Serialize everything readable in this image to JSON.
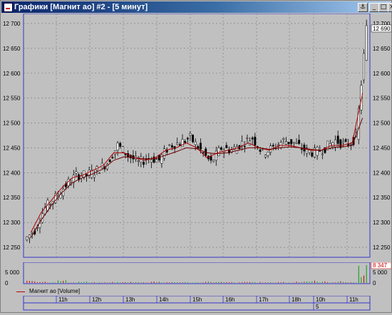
{
  "window": {
    "title": "Графики [Магнит ао] #2 - [5 минут]",
    "buttons": [
      "⚓",
      "_",
      "□",
      "×"
    ]
  },
  "legend": {
    "label": "Магнит ао [Volume]",
    "color": "#b00000"
  },
  "price_axis": {
    "ticks": [
      "12 700",
      "12 650",
      "12 600",
      "12 550",
      "12 500",
      "12 450",
      "12 400",
      "12 350",
      "12 300",
      "12 250"
    ],
    "last_price": "12 690"
  },
  "volume_axis": {
    "ticks": [
      "5 000",
      "0"
    ],
    "last_volume": "8 347"
  },
  "time_axis": {
    "labels": [
      "11h",
      "12h",
      "13h",
      "14h",
      "15h",
      "16h",
      "17h",
      "18h",
      "10h",
      "11h"
    ],
    "date_label": "5"
  },
  "chart_data": {
    "type": "candlestick",
    "ylim": [
      12230,
      12720
    ],
    "x": [
      "11h",
      "12h",
      "13h",
      "14h",
      "15h",
      "16h",
      "17h",
      "18h",
      "10h",
      "11h"
    ],
    "close": [
      12285,
      12330,
      12350,
      12375,
      12395,
      12395,
      12405,
      12420,
      12455,
      12435,
      12420,
      12430,
      12425,
      12455,
      12460,
      12470,
      12445,
      12420,
      12450,
      12445,
      12460,
      12470,
      12440,
      12450,
      12465,
      12460,
      12445,
      12440,
      12450,
      12465,
      12455,
      12470,
      12690
    ],
    "ma_fast": [
      12280,
      12320,
      12345,
      12370,
      12390,
      12395,
      12405,
      12415,
      12440,
      12440,
      12430,
      12425,
      12430,
      12445,
      12450,
      12460,
      12450,
      12430,
      12440,
      12445,
      12450,
      12460,
      12450,
      12445,
      12455,
      12455,
      12450,
      12445,
      12445,
      12455,
      12455,
      12460,
      12560
    ],
    "ma_slow": [
      12270,
      12305,
      12335,
      12360,
      12380,
      12390,
      12398,
      12408,
      12425,
      12432,
      12430,
      12428,
      12428,
      12435,
      12442,
      12450,
      12448,
      12440,
      12438,
      12440,
      12445,
      12450,
      12450,
      12447,
      12450,
      12452,
      12450,
      12447,
      12445,
      12450,
      12452,
      12455,
      12510
    ],
    "volume": [
      1500,
      700,
      500,
      1200,
      400,
      600,
      300,
      300,
      500,
      400,
      600,
      300,
      800,
      300,
      500,
      400,
      300,
      700,
      500,
      400,
      300,
      600,
      400,
      300,
      500,
      300,
      800,
      1000,
      700,
      500,
      700,
      400,
      8347
    ]
  }
}
